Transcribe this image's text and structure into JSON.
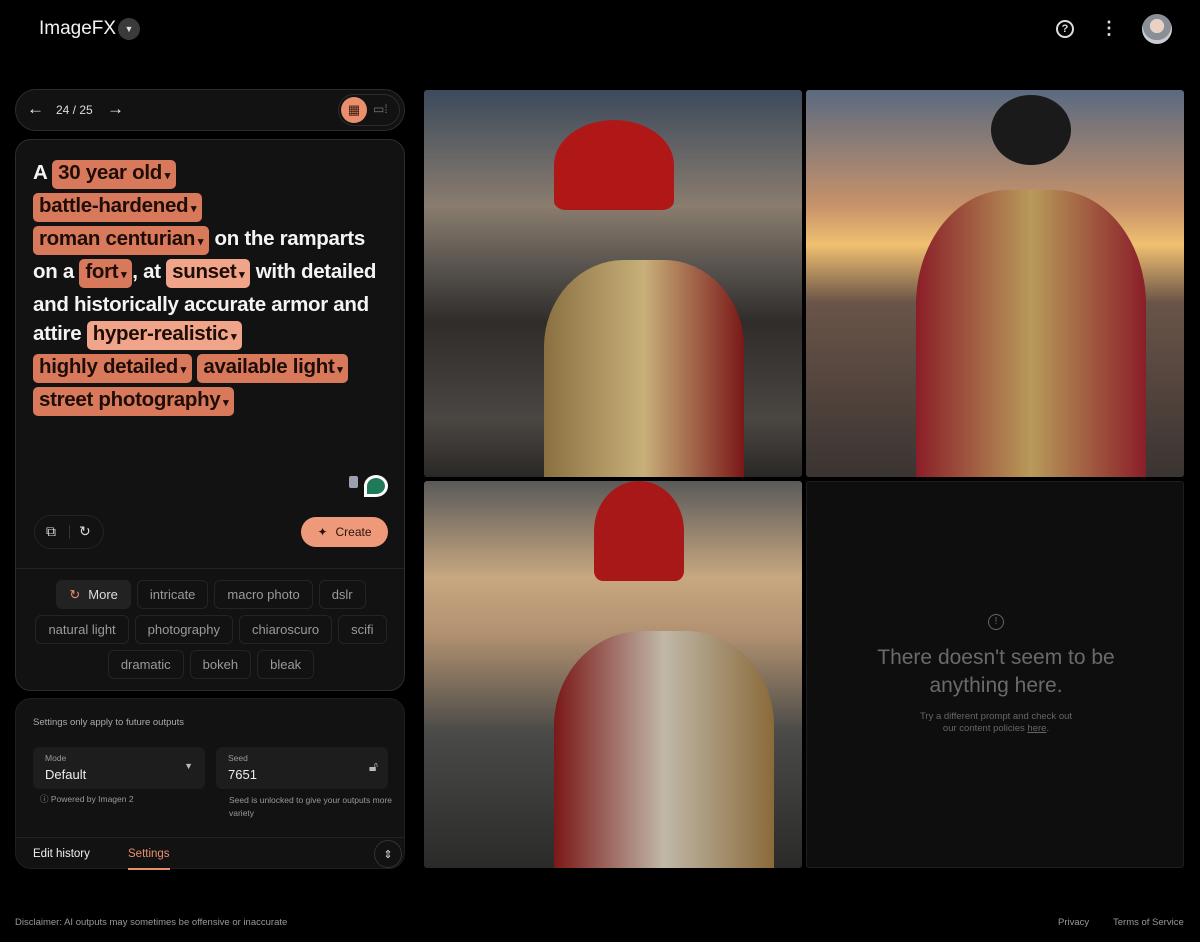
{
  "header": {
    "title": "ImageFX",
    "title_dropdown_icon": "chevron-down-icon",
    "help_icon": "help-circle-icon",
    "menu_icon": "more-vert-icon",
    "avatar": "user-avatar"
  },
  "nav": {
    "prev_icon": "arrow-left-icon",
    "next_icon": "arrow-right-icon",
    "pager": "24 / 25",
    "view_grid_icon": "grid-view-icon",
    "view_single_icon": "single-view-icon",
    "selected_view": "grid"
  },
  "prompt": {
    "segments": [
      {
        "text": "A ",
        "chip": false
      },
      {
        "text": "30 year old",
        "chip": true
      },
      {
        "text": "battle-hardened",
        "chip": true
      },
      {
        "text": "roman centurian",
        "chip": true
      },
      {
        "text": " on the ramparts on a ",
        "chip": false
      },
      {
        "text": "fort",
        "chip": true
      },
      {
        "text": ", at ",
        "chip": false
      },
      {
        "text": "sunset",
        "chip": true
      },
      {
        "text": " with detailed and historically accurate armor and attire ",
        "chip": false
      },
      {
        "text": "hyper-realistic",
        "chip": true
      },
      {
        "text": "highly detailed",
        "chip": true
      },
      {
        "text": "available light",
        "chip": true
      },
      {
        "text": "street photography",
        "chip": true
      }
    ],
    "chip_color": "#d8795b",
    "copy_icon": "copy-icon",
    "reset_icon": "refresh-icon",
    "create_label": "Create",
    "create_icon": "sparkle-icon"
  },
  "suggestions": {
    "more_label": "More",
    "items": [
      "intricate",
      "macro photo",
      "dslr",
      "natural light",
      "photography",
      "chiaroscuro",
      "scifi",
      "dramatic",
      "bokeh",
      "bleak"
    ]
  },
  "settings": {
    "note": "Settings only apply to future outputs",
    "mode_label": "Mode",
    "mode_value": "Default",
    "powered_by": "Powered by Imagen 2",
    "seed_label": "Seed",
    "seed_value": "7651",
    "seed_hint": "Seed is unlocked to give your outputs more variety",
    "seed_lock_icon": "unlock-icon",
    "tabs": [
      "Edit history",
      "Settings"
    ],
    "active_tab": "Settings"
  },
  "empty": {
    "title": "There doesn't seem to be anything here.",
    "body": "Try a different prompt and check out our content policies ",
    "link": "here",
    "icon": "alert-circle-icon"
  },
  "footer": {
    "disclaimer": "Disclaimer: AI outputs may sometimes be offensive or inaccurate",
    "privacy": "Privacy",
    "terms": "Terms of Service"
  },
  "accent": "#e98f6e"
}
